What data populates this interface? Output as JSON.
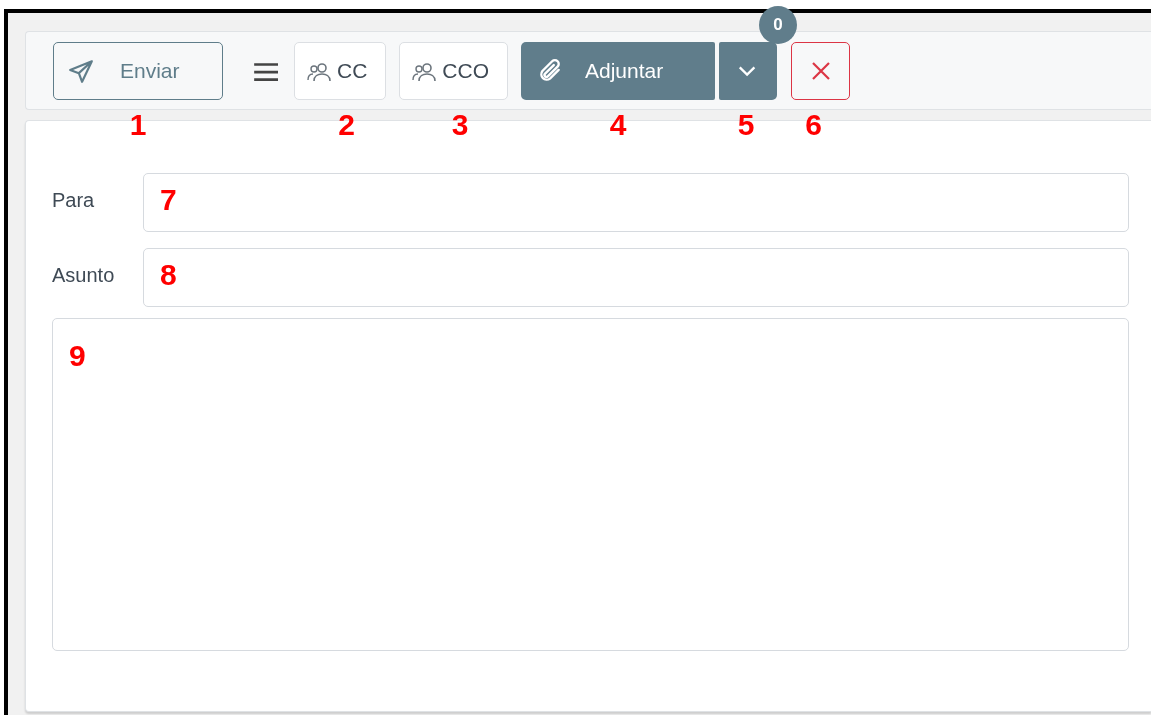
{
  "toolbar": {
    "buttons": [
      {
        "kind": "send",
        "label": "Enviar",
        "callout": "1"
      },
      {
        "kind": "menu"
      },
      {
        "kind": "people",
        "label": "CC",
        "callout": "2"
      },
      {
        "kind": "people",
        "label": "CCO",
        "callout": "3"
      },
      {
        "kind": "attach",
        "label": "Adjuntar",
        "callout": "4"
      },
      {
        "kind": "caret",
        "badge": "0",
        "callout": "5"
      },
      {
        "kind": "close",
        "callout": "6"
      }
    ]
  },
  "fields": [
    {
      "label": "Para",
      "callout": "7"
    },
    {
      "label": "Asunto",
      "callout": "8"
    }
  ],
  "body": {
    "callout": "9"
  }
}
